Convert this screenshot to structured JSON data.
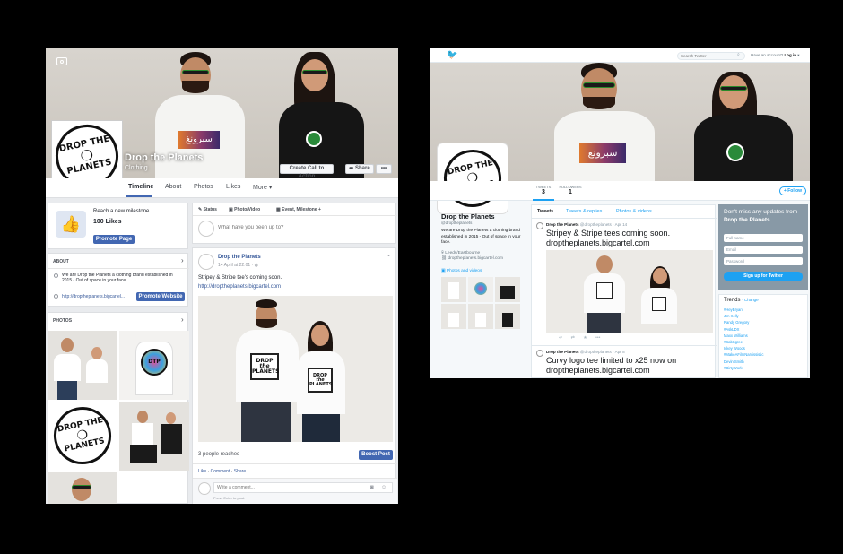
{
  "facebook": {
    "page_name": "Drop the Planets",
    "category": "Clothing",
    "cover_buttons": {
      "cta": "Create Call to Action",
      "share": "Share",
      "more": "•••"
    },
    "logo_text": {
      "line1": "DROP THE",
      "line2": "PLANETS"
    },
    "shirt_text": "سبرونغ",
    "tabs": [
      "Timeline",
      "About",
      "Photos",
      "Likes",
      "More"
    ],
    "milestone": {
      "text": "Reach a new milestone",
      "likes": "100 Likes",
      "button": "Promote Page"
    },
    "about": {
      "heading": "ABOUT",
      "description": "We are Drop the Planets a clothing brand established in 2015 - Out of space in your face.",
      "website": "http://droptheplanets.bigcartel...",
      "promote_button": "Promote Website"
    },
    "photos_heading": "PHOTOS",
    "composer": {
      "tabs": [
        "Status",
        "Photo/Video",
        "Event, Milestone +"
      ],
      "placeholder": "What have you been up to?"
    },
    "post": {
      "author": "Drop the Planets",
      "time": "14 April at 22:01 · ",
      "text": "Stripey & Stripe tee's coming soon.",
      "link": "http://droptheplanets.bigcartel.com",
      "shirt_text": {
        "line1": "DROP",
        "line2": "the",
        "line3": "PLANETS"
      },
      "reach": "3 people reached",
      "boost_button": "Boost Post",
      "actions": [
        "Like",
        "Comment",
        "Share"
      ],
      "comment_placeholder": "Write a comment...",
      "comment_hint": "Press Enter to post."
    }
  },
  "twitter": {
    "search_placeholder": "Search Twitter",
    "login_text": "Have an account?",
    "login_link": "Log in",
    "stats": [
      {
        "label": "TWEETS",
        "value": "3"
      },
      {
        "label": "FOLLOWERS",
        "value": "1"
      }
    ],
    "follow_button": "Follow",
    "profile": {
      "name": "Drop the Planets",
      "handle": "@droptheplanets",
      "bio": "We are Drop the Planets a clothing brand established in 2015 - Out of space in your face.",
      "location": "Leeds/Eastbourne",
      "url": "droptheplanets.bigcartel.com",
      "photos_heading": "Photos and videos"
    },
    "tabs": [
      "Tweets",
      "Tweets & replies",
      "Photos & videos"
    ],
    "tweets": [
      {
        "author": "Drop the Planets",
        "meta": "@droptheplanets · Apr 14",
        "line1": "Stripey & Stripe tees coming soon.",
        "line2": "droptheplanets.bigcartel.com"
      },
      {
        "author": "Drop the Planets",
        "meta": "@droptheplanets · Apr 8",
        "line1": "Curvy logo tee limited to x25 now on",
        "line2": "droptheplanets.bigcartel.com"
      }
    ],
    "signup": {
      "heading": "Don't miss any updates from",
      "heading_bold": "Drop the Planets",
      "fields": [
        "Full name",
        "Email",
        "Password"
      ],
      "button": "Sign up for Twitter"
    },
    "trends": {
      "heading": "Trends",
      "change": "· Change",
      "items": [
        "#HeyBryant",
        "Jim Kelly",
        "Randy Gregory",
        "#AskLDX",
        "Maxx Williams",
        "#SabSgree",
        "Ickey Woods",
        "#MakeAFilmNarcissistic",
        "Devin Smith",
        "#DirtyWork"
      ]
    }
  },
  "colors": {
    "fb_blue": "#4267b2",
    "fb_link": "#365899",
    "twitter_blue": "#1da1f2",
    "shirt_orange": "#e07a2e",
    "shirt_purple": "#3b2a6a"
  }
}
